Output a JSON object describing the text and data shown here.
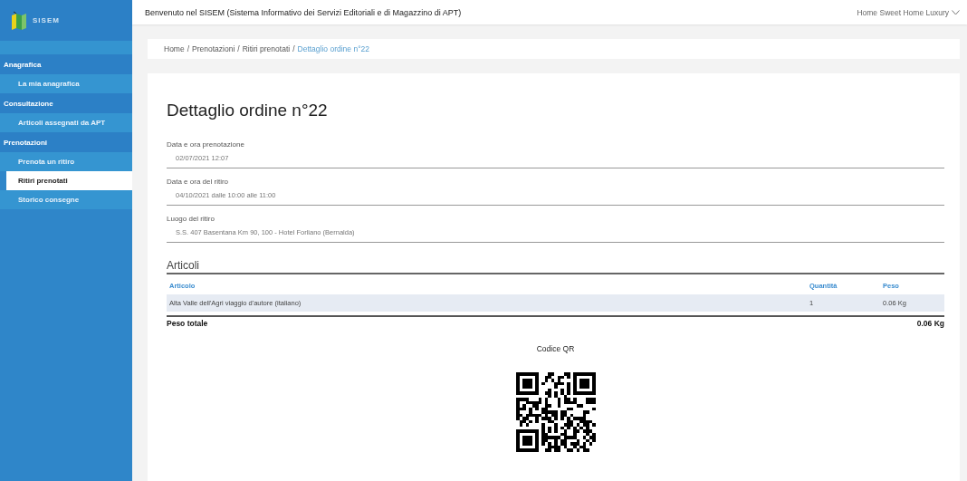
{
  "logo": {
    "text": "SISEM"
  },
  "header": {
    "title": "Benvenuto nel SISEM (Sistema Informativo dei Servizi Editoriali e di Magazzino di APT)",
    "user": "Home Sweet Home Luxury"
  },
  "sidebar": {
    "sections": [
      {
        "label": "Anagrafica",
        "items": [
          {
            "label": "La mia anagrafica",
            "selected": false
          }
        ]
      },
      {
        "label": "Consultazione",
        "items": [
          {
            "label": "Articoli assegnati da APT",
            "selected": false
          }
        ]
      },
      {
        "label": "Prenotazioni",
        "items": [
          {
            "label": "Prenota un ritiro",
            "selected": false
          },
          {
            "label": "Ritiri prenotati",
            "selected": true
          },
          {
            "label": "Storico consegne",
            "selected": false
          }
        ]
      }
    ]
  },
  "breadcrumb_separator": "/",
  "breadcrumb": [
    {
      "label": "Home",
      "current": false
    },
    {
      "label": "Prenotazioni",
      "current": false
    },
    {
      "label": "Ritiri prenotati",
      "current": false
    },
    {
      "label": "Dettaglio ordine n°22",
      "current": true
    }
  ],
  "page_title": "Dettaglio ordine n°22",
  "fields": [
    {
      "label": "Data e ora prenotazione",
      "value": "02/07/2021 12:07"
    },
    {
      "label": "Data e ora del ritiro",
      "value": "04/10/2021 dalle 10:00 alle 11:00"
    },
    {
      "label": "Luogo del ritiro",
      "value": "S.S. 407 Basentana Km 90, 100 - Hotel Forliano (Bernalda)"
    }
  ],
  "articles": {
    "title": "Articoli",
    "columns": [
      "Articolo",
      "Quantità",
      "Peso"
    ],
    "rows": [
      [
        "Alta Valle dell'Agri viaggio d'autore (italiano)",
        "1",
        "0.06 Kg"
      ]
    ],
    "total_label": "Peso totale",
    "total_value": "0.06 Kg"
  },
  "qr": {
    "label": "Codice QR"
  }
}
